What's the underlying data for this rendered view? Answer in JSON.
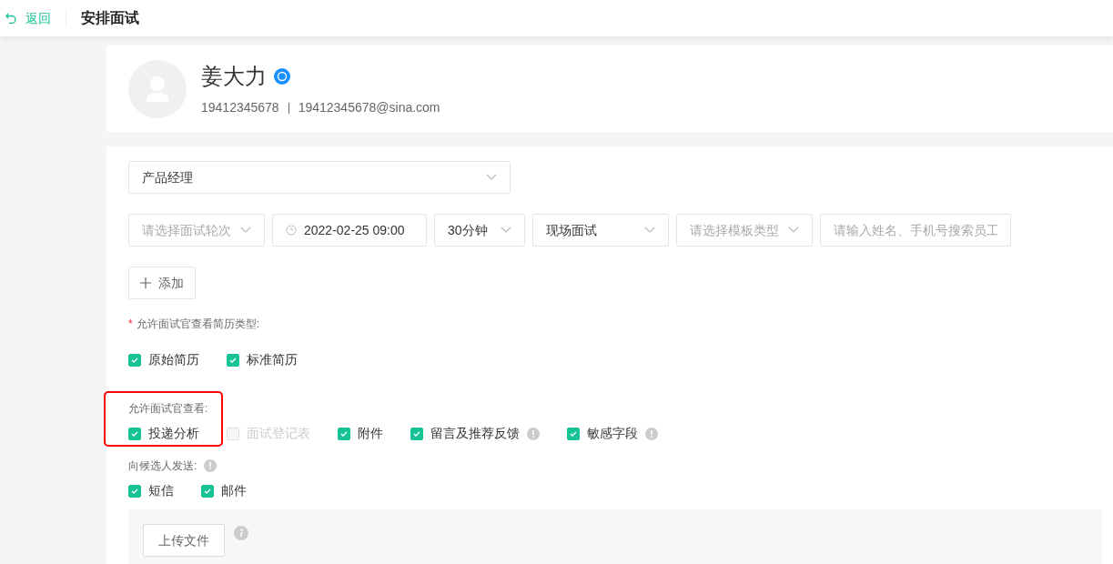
{
  "header": {
    "back": "返回",
    "title": "安排面试"
  },
  "candidate": {
    "name": "姜大力",
    "verified": true,
    "phone": "19412345678",
    "email": "19412345678@sina.com"
  },
  "position": {
    "value": "产品经理"
  },
  "fields": [
    {
      "kind": "select",
      "placeholder": "请选择面试轮次"
    },
    {
      "kind": "date",
      "value": "2022-02-25 09:00"
    },
    {
      "kind": "select",
      "value": "30分钟"
    },
    {
      "kind": "select",
      "value": "现场面试"
    },
    {
      "kind": "select",
      "placeholder": "请选择模板类型"
    },
    {
      "kind": "input",
      "placeholder": "请输入姓名、手机号搜索员工"
    }
  ],
  "add_button": "添加",
  "groups": [
    {
      "marker": "*",
      "label": "允许面试官查看简历类型:",
      "highlighted": false,
      "info": false,
      "items": [
        {
          "label": "原始简历",
          "checked": true,
          "disabled": false,
          "info": false
        },
        {
          "label": "标准简历",
          "checked": true,
          "disabled": false,
          "info": false
        }
      ]
    },
    {
      "label": "允许面试官查看:",
      "highlighted": true,
      "info": false,
      "items": [
        {
          "label": "投递分析",
          "checked": true,
          "disabled": false,
          "info": false
        },
        {
          "label": "面试登记表",
          "checked": false,
          "disabled": true,
          "info": false
        },
        {
          "label": "附件",
          "checked": true,
          "disabled": false,
          "info": false
        },
        {
          "label": "留言及推荐反馈",
          "checked": true,
          "disabled": false,
          "info": true
        },
        {
          "label": "敏感字段",
          "checked": true,
          "disabled": false,
          "info": true
        }
      ]
    },
    {
      "label": "向候选人发送:",
      "highlighted": false,
      "info": true,
      "items": [
        {
          "label": "短信",
          "checked": true,
          "disabled": false,
          "info": false
        },
        {
          "label": "邮件",
          "checked": true,
          "disabled": false,
          "info": false
        }
      ]
    }
  ],
  "upload_button": "上传文件"
}
